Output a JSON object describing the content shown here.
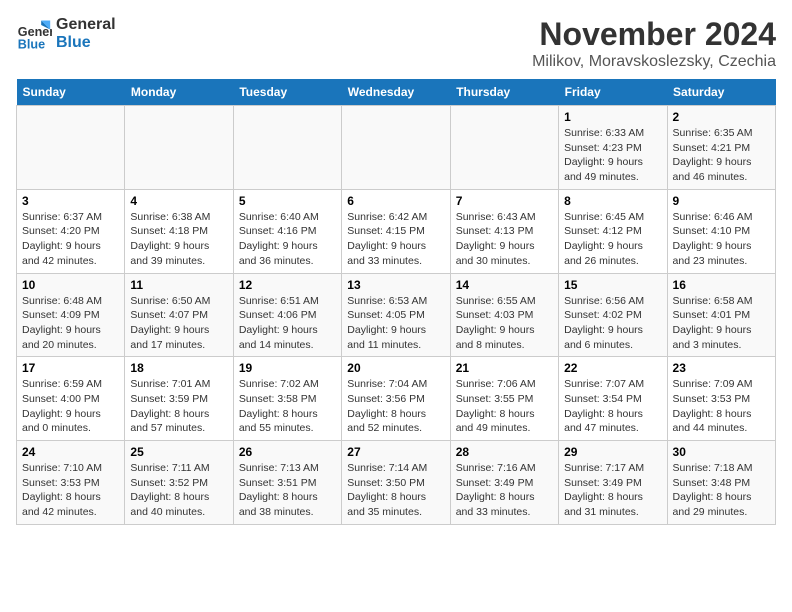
{
  "header": {
    "logo_line1": "General",
    "logo_line2": "Blue",
    "title": "November 2024",
    "subtitle": "Milikov, Moravskoslezsky, Czechia"
  },
  "weekdays": [
    "Sunday",
    "Monday",
    "Tuesday",
    "Wednesday",
    "Thursday",
    "Friday",
    "Saturday"
  ],
  "weeks": [
    [
      {
        "day": "",
        "info": ""
      },
      {
        "day": "",
        "info": ""
      },
      {
        "day": "",
        "info": ""
      },
      {
        "day": "",
        "info": ""
      },
      {
        "day": "",
        "info": ""
      },
      {
        "day": "1",
        "info": "Sunrise: 6:33 AM\nSunset: 4:23 PM\nDaylight: 9 hours\nand 49 minutes."
      },
      {
        "day": "2",
        "info": "Sunrise: 6:35 AM\nSunset: 4:21 PM\nDaylight: 9 hours\nand 46 minutes."
      }
    ],
    [
      {
        "day": "3",
        "info": "Sunrise: 6:37 AM\nSunset: 4:20 PM\nDaylight: 9 hours\nand 42 minutes."
      },
      {
        "day": "4",
        "info": "Sunrise: 6:38 AM\nSunset: 4:18 PM\nDaylight: 9 hours\nand 39 minutes."
      },
      {
        "day": "5",
        "info": "Sunrise: 6:40 AM\nSunset: 4:16 PM\nDaylight: 9 hours\nand 36 minutes."
      },
      {
        "day": "6",
        "info": "Sunrise: 6:42 AM\nSunset: 4:15 PM\nDaylight: 9 hours\nand 33 minutes."
      },
      {
        "day": "7",
        "info": "Sunrise: 6:43 AM\nSunset: 4:13 PM\nDaylight: 9 hours\nand 30 minutes."
      },
      {
        "day": "8",
        "info": "Sunrise: 6:45 AM\nSunset: 4:12 PM\nDaylight: 9 hours\nand 26 minutes."
      },
      {
        "day": "9",
        "info": "Sunrise: 6:46 AM\nSunset: 4:10 PM\nDaylight: 9 hours\nand 23 minutes."
      }
    ],
    [
      {
        "day": "10",
        "info": "Sunrise: 6:48 AM\nSunset: 4:09 PM\nDaylight: 9 hours\nand 20 minutes."
      },
      {
        "day": "11",
        "info": "Sunrise: 6:50 AM\nSunset: 4:07 PM\nDaylight: 9 hours\nand 17 minutes."
      },
      {
        "day": "12",
        "info": "Sunrise: 6:51 AM\nSunset: 4:06 PM\nDaylight: 9 hours\nand 14 minutes."
      },
      {
        "day": "13",
        "info": "Sunrise: 6:53 AM\nSunset: 4:05 PM\nDaylight: 9 hours\nand 11 minutes."
      },
      {
        "day": "14",
        "info": "Sunrise: 6:55 AM\nSunset: 4:03 PM\nDaylight: 9 hours\nand 8 minutes."
      },
      {
        "day": "15",
        "info": "Sunrise: 6:56 AM\nSunset: 4:02 PM\nDaylight: 9 hours\nand 6 minutes."
      },
      {
        "day": "16",
        "info": "Sunrise: 6:58 AM\nSunset: 4:01 PM\nDaylight: 9 hours\nand 3 minutes."
      }
    ],
    [
      {
        "day": "17",
        "info": "Sunrise: 6:59 AM\nSunset: 4:00 PM\nDaylight: 9 hours\nand 0 minutes."
      },
      {
        "day": "18",
        "info": "Sunrise: 7:01 AM\nSunset: 3:59 PM\nDaylight: 8 hours\nand 57 minutes."
      },
      {
        "day": "19",
        "info": "Sunrise: 7:02 AM\nSunset: 3:58 PM\nDaylight: 8 hours\nand 55 minutes."
      },
      {
        "day": "20",
        "info": "Sunrise: 7:04 AM\nSunset: 3:56 PM\nDaylight: 8 hours\nand 52 minutes."
      },
      {
        "day": "21",
        "info": "Sunrise: 7:06 AM\nSunset: 3:55 PM\nDaylight: 8 hours\nand 49 minutes."
      },
      {
        "day": "22",
        "info": "Sunrise: 7:07 AM\nSunset: 3:54 PM\nDaylight: 8 hours\nand 47 minutes."
      },
      {
        "day": "23",
        "info": "Sunrise: 7:09 AM\nSunset: 3:53 PM\nDaylight: 8 hours\nand 44 minutes."
      }
    ],
    [
      {
        "day": "24",
        "info": "Sunrise: 7:10 AM\nSunset: 3:53 PM\nDaylight: 8 hours\nand 42 minutes."
      },
      {
        "day": "25",
        "info": "Sunrise: 7:11 AM\nSunset: 3:52 PM\nDaylight: 8 hours\nand 40 minutes."
      },
      {
        "day": "26",
        "info": "Sunrise: 7:13 AM\nSunset: 3:51 PM\nDaylight: 8 hours\nand 38 minutes."
      },
      {
        "day": "27",
        "info": "Sunrise: 7:14 AM\nSunset: 3:50 PM\nDaylight: 8 hours\nand 35 minutes."
      },
      {
        "day": "28",
        "info": "Sunrise: 7:16 AM\nSunset: 3:49 PM\nDaylight: 8 hours\nand 33 minutes."
      },
      {
        "day": "29",
        "info": "Sunrise: 7:17 AM\nSunset: 3:49 PM\nDaylight: 8 hours\nand 31 minutes."
      },
      {
        "day": "30",
        "info": "Sunrise: 7:18 AM\nSunset: 3:48 PM\nDaylight: 8 hours\nand 29 minutes."
      }
    ]
  ]
}
